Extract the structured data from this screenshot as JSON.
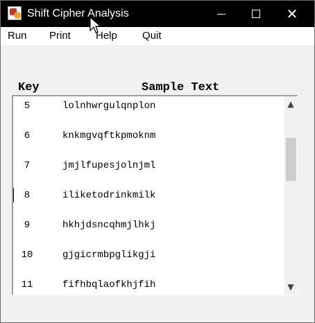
{
  "window": {
    "title": "Shift Cipher Analysis"
  },
  "menu": [
    "Run",
    "Print",
    "Help",
    "Quit"
  ],
  "headers": {
    "key": "Key",
    "sample": "Sample Text"
  },
  "rows": [
    {
      "key": "5",
      "text": "lolnhwrgulqnplon"
    },
    {
      "key": "6",
      "text": "knkmgvqftkpmoknm"
    },
    {
      "key": "7",
      "text": "jmjlfupesjolnjml"
    },
    {
      "key": "8",
      "text": "iliketodrinkmilk"
    },
    {
      "key": "9",
      "text": "hkhjdsncqhmjlhkj"
    },
    {
      "key": "10",
      "text": "gjgicrmbpglikgji"
    },
    {
      "key": "11",
      "text": "fifhbqlaofkhjfih"
    }
  ],
  "icons": {
    "scroll_up": "▲",
    "scroll_down": "▼"
  }
}
